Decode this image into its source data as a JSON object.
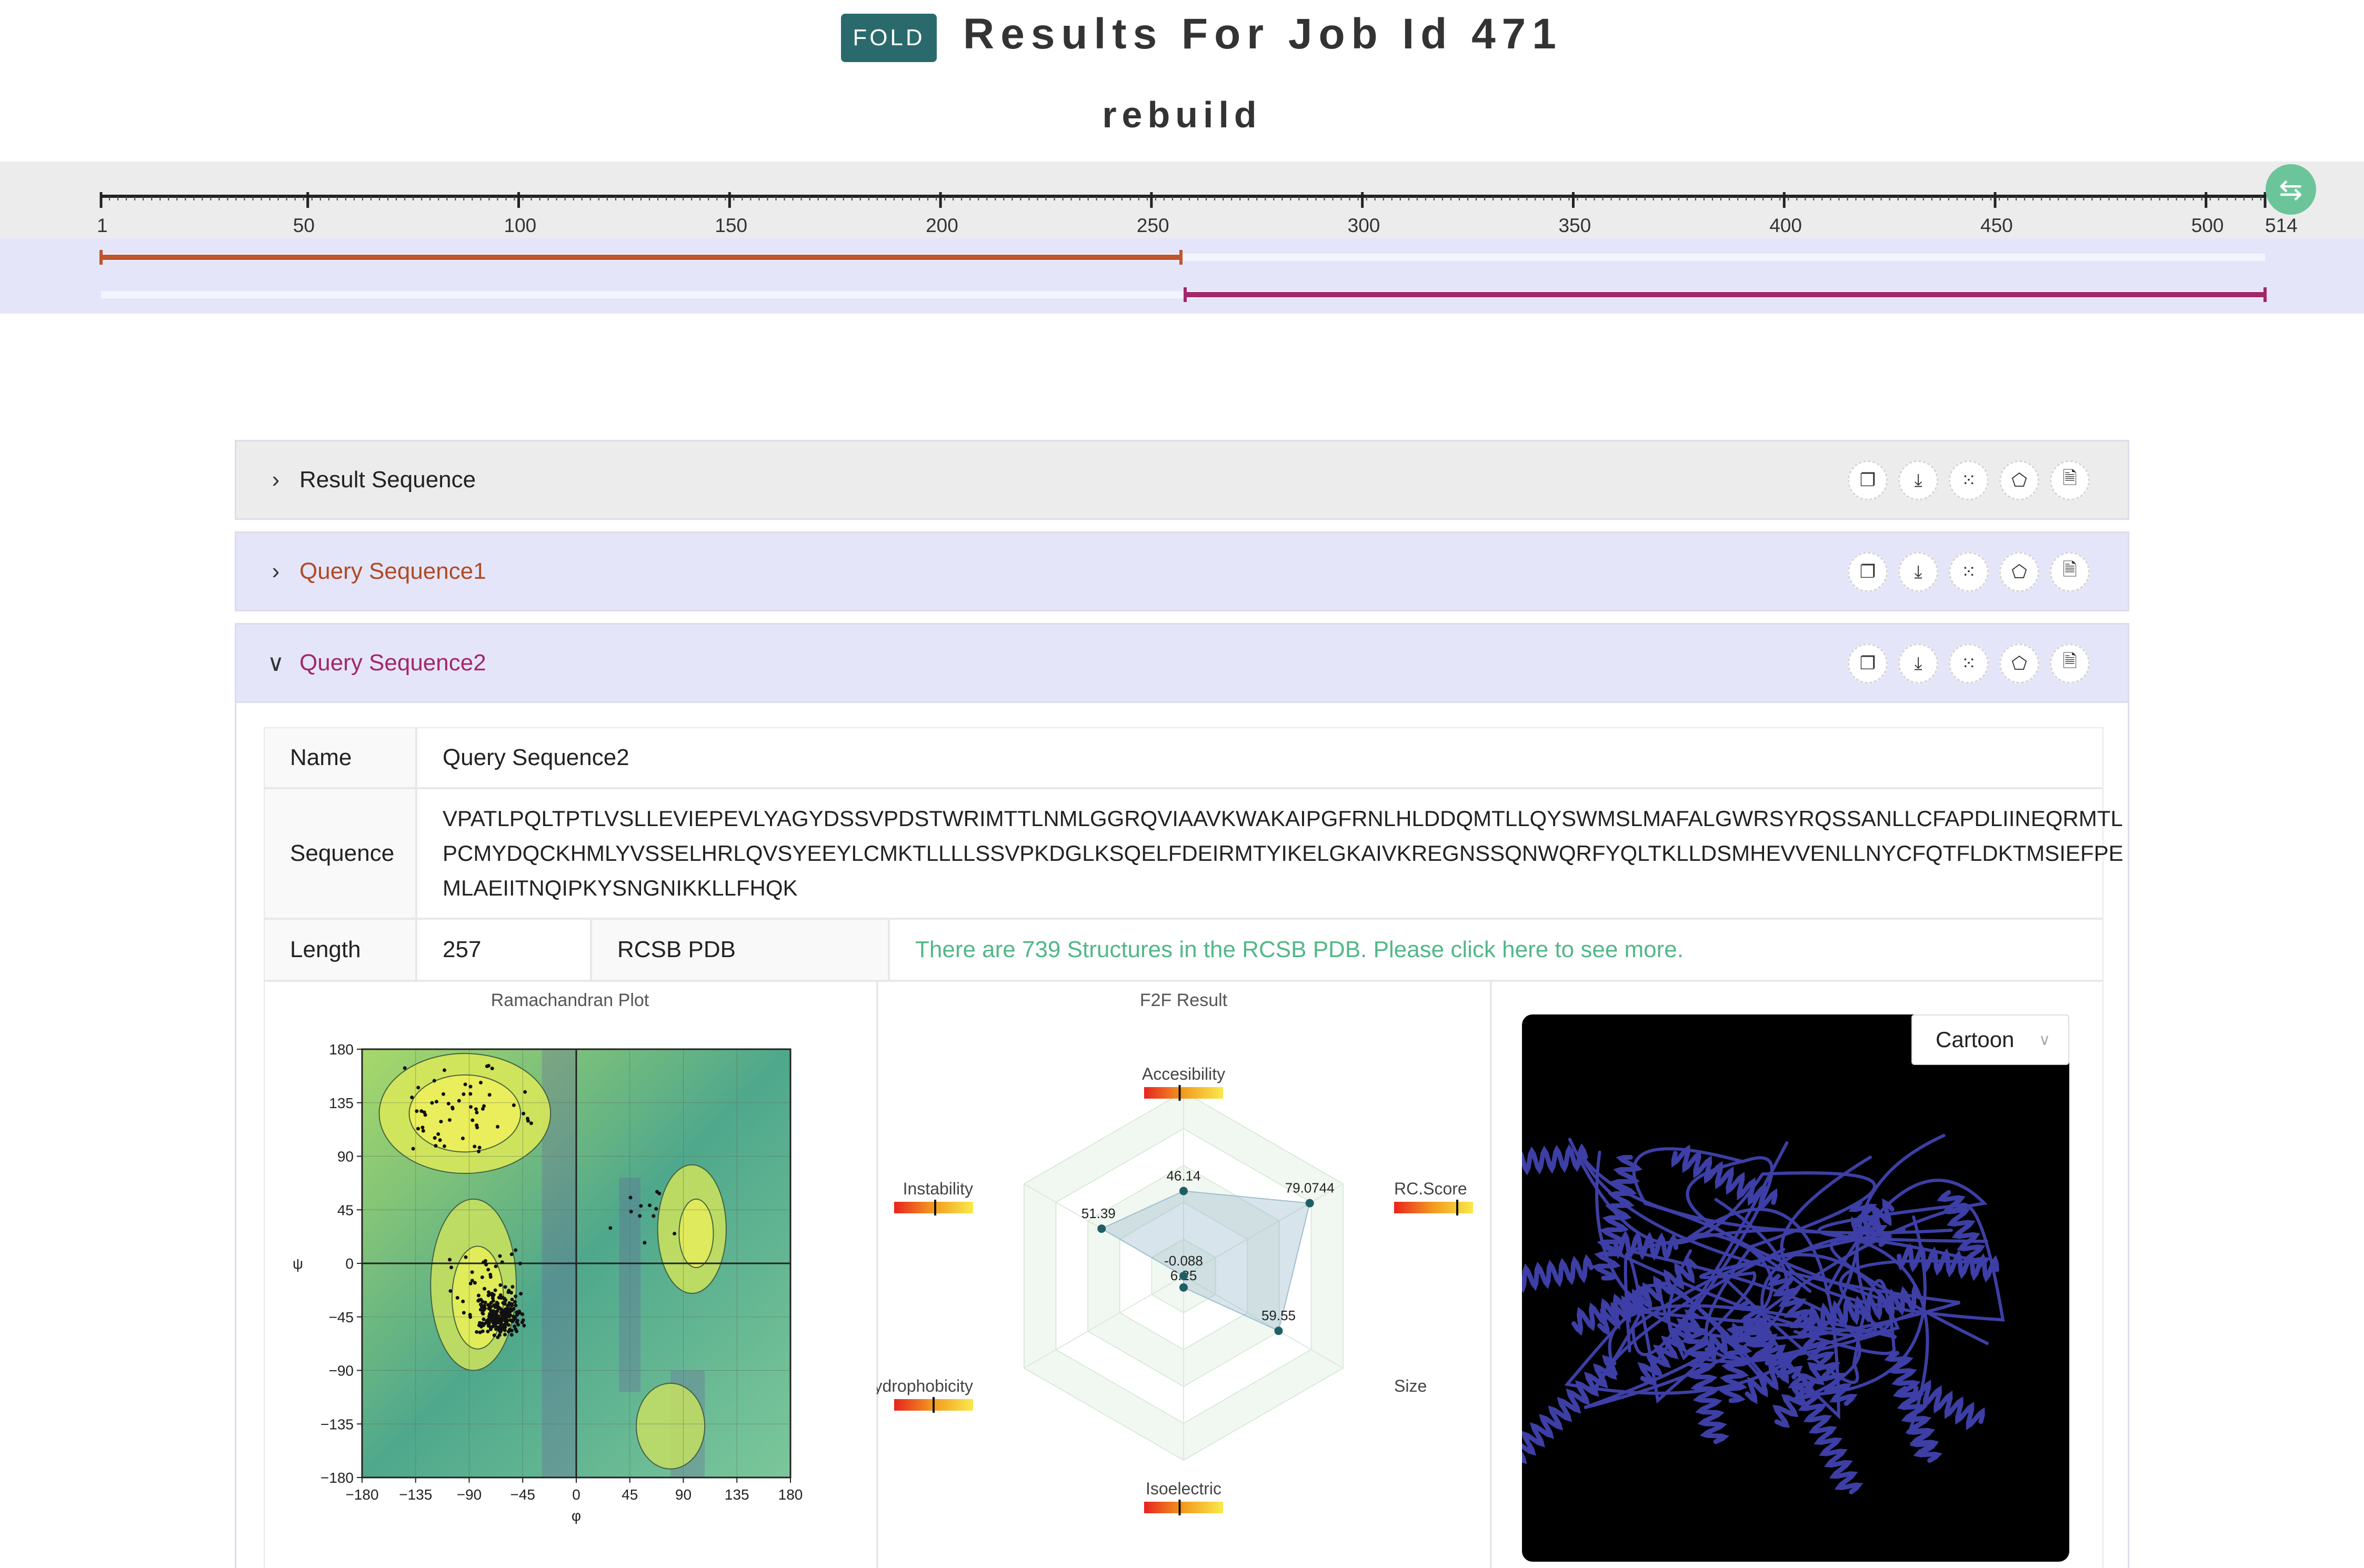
{
  "header": {
    "badge": "FOLD",
    "title": "Results For Job Id 471",
    "subtitle": "rebuild"
  },
  "track": {
    "ticks": [
      1,
      50,
      100,
      150,
      200,
      250,
      300,
      350,
      400,
      450,
      500,
      514
    ],
    "total_length": 514,
    "segments": [
      {
        "name": "Query Sequence1",
        "start": 1,
        "end": 257,
        "color": "#c0542c"
      },
      {
        "name": "Query Sequence2",
        "start": 258,
        "end": 514,
        "color": "#a3276b"
      }
    ],
    "swap_icon": "swap-arrows-icon"
  },
  "panels": [
    {
      "title": "Result Sequence",
      "expanded": false,
      "color": "#222222"
    },
    {
      "title": "Query Sequence1",
      "expanded": false,
      "color": "#b04a22"
    },
    {
      "title": "Query Sequence2",
      "expanded": true,
      "color": "#a3276b"
    }
  ],
  "panel_actions": [
    "copy-icon",
    "download-icon",
    "scatter-plot-icon",
    "pentagon-icon",
    "pdf-file-icon"
  ],
  "detail": {
    "name_label": "Name",
    "name_value": "Query Sequence2",
    "sequence_label": "Sequence",
    "sequence_lines": [
      "VPATLPQLTPTLVSLLEVIEPEVLYAGYDSSVPDSTWRIMTTLNMLGGRQVIAAVKWAKAIPGFRNLHLDDQMTLLQYSWMSLMAFALGWRSYRQSSANLLCFAPDLIINEQRMTL",
      "PCMYDQCKHMLYVSSELHRLQVSYEEYLCMKTLLLLSSVPKDGLKSQELFDEIRMTYIKELGKAIVKREGNSSQNWQRFYQLTKLLDSMHEVVENLLNYCFQTFLDKTMSIEFPE",
      "MLAEIITNQIPKYSNGNIKKLLFHQK"
    ],
    "length_label": "Length",
    "length_value": "257",
    "rcsb_label": "RCSB PDB",
    "rcsb_link": "There are 739 Structures in the RCSB PDB. Please click here to see more.",
    "link_color": "#52b788"
  },
  "ramachandran": {
    "title": "Ramachandran Plot",
    "x_label": "φ",
    "y_label": "ψ",
    "x_ticks": [
      "−180",
      "−135",
      "−90",
      "−45",
      "0",
      "45",
      "90",
      "135",
      "180"
    ],
    "y_ticks": [
      "180",
      "135",
      "90",
      "45",
      "0",
      "−45",
      "−90",
      "−135",
      "−180"
    ]
  },
  "chart_data": {
    "type": "radar",
    "title": "F2F Result",
    "axes": [
      "Accesibility",
      "RC.Score",
      "Size",
      "Isoelectric",
      "Hydrophobicity",
      "Instability"
    ],
    "axis_max": 100,
    "series": [
      {
        "values": [
          46.14,
          79.0744,
          59.55,
          6.25,
          -0.088,
          51.39
        ]
      }
    ],
    "value_labels": [
      "46.14",
      "79.0744",
      "59.55",
      "6.25",
      "-0.088",
      "51.39"
    ],
    "gauges": {
      "Accesibility": 0.45,
      "RC.Score": 0.8,
      "Isoelectric": 0.45,
      "Hydrophobicity": 0.5,
      "Instability": 0.52
    }
  },
  "viewer": {
    "style_value": "Cartoon",
    "style_options": [
      "Cartoon"
    ]
  }
}
